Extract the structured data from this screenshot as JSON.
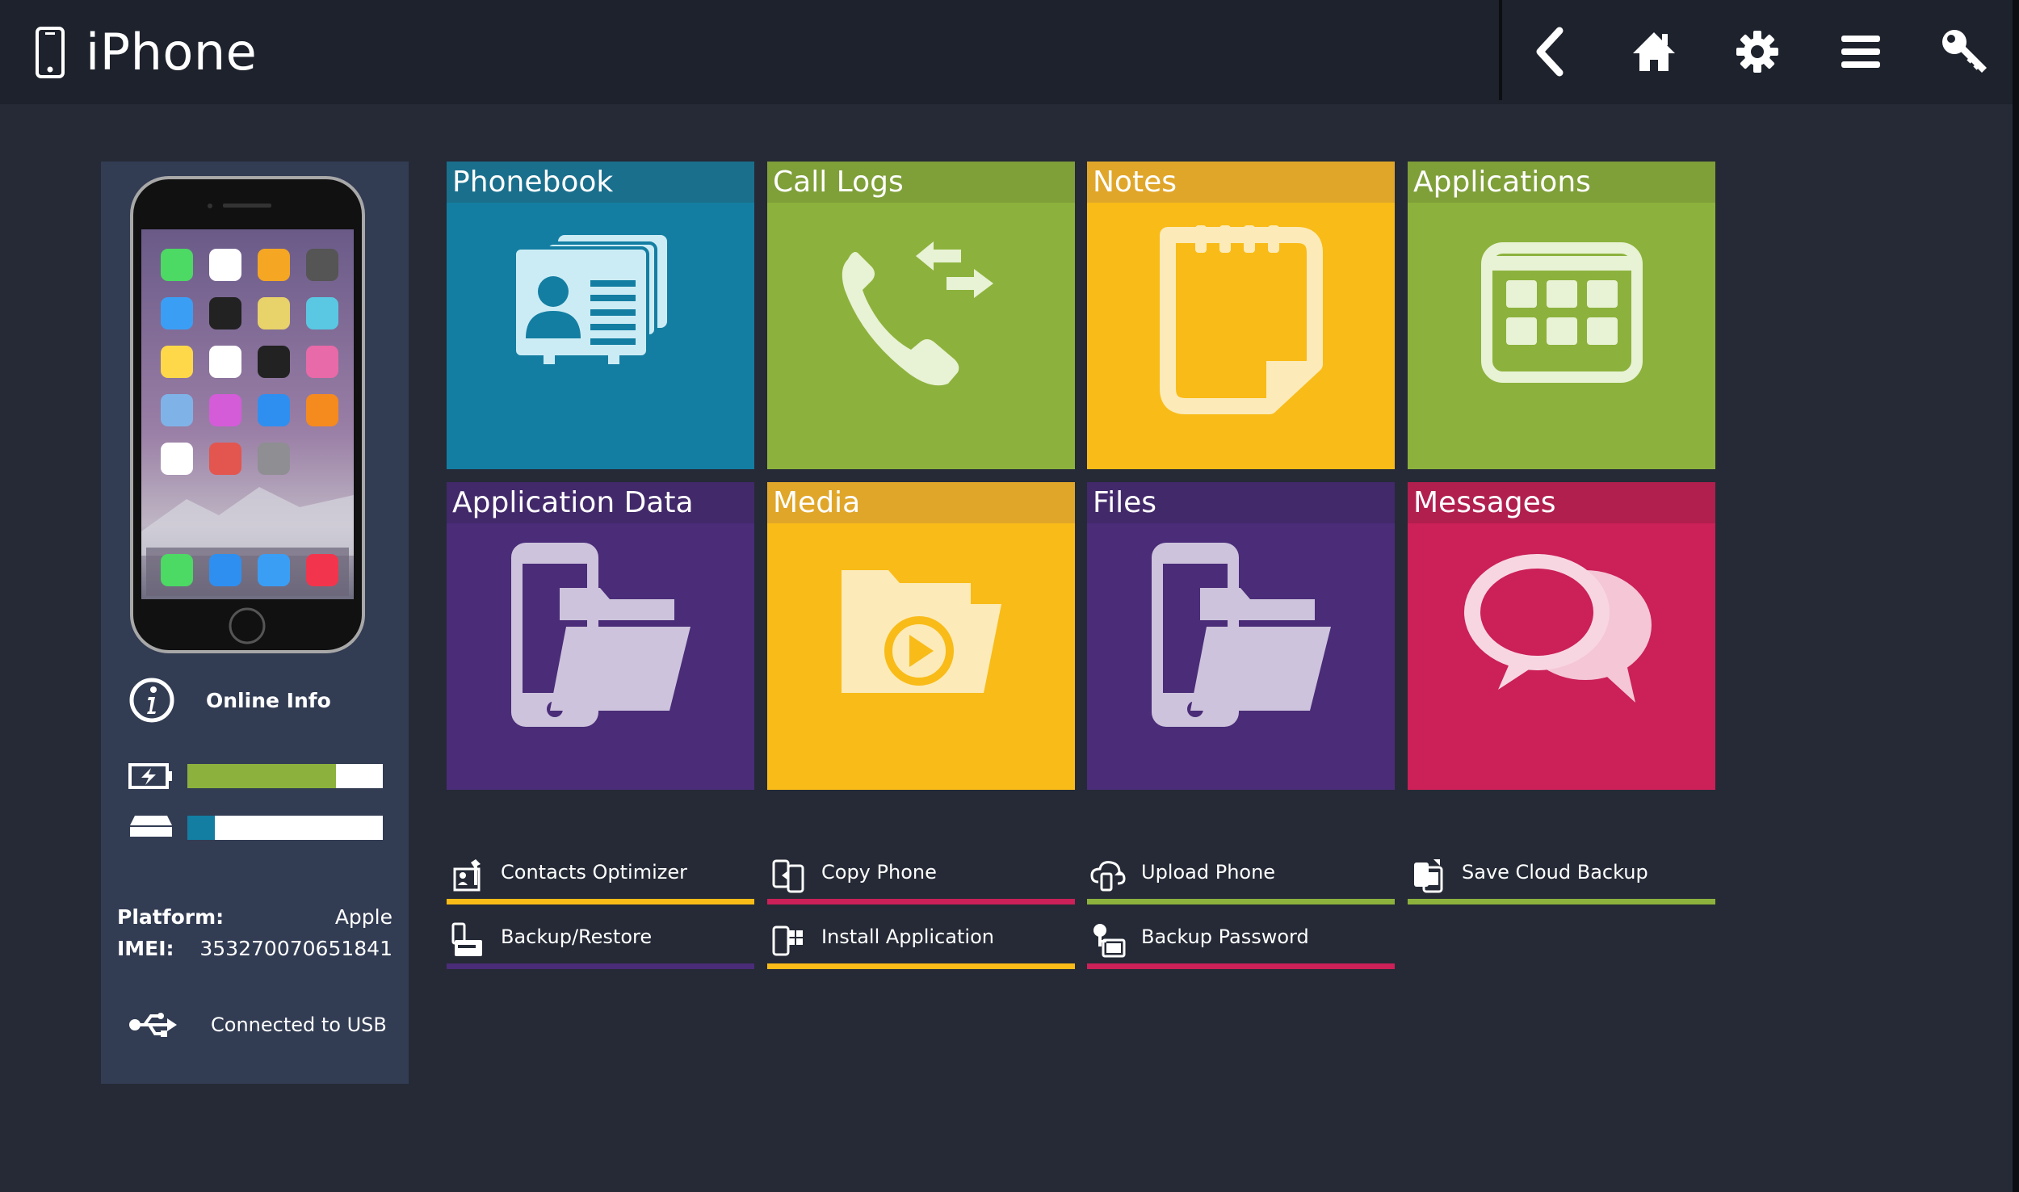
{
  "header": {
    "title": "iPhone",
    "buttons": [
      {
        "name": "back-button",
        "icon": "chevron-left-icon"
      },
      {
        "name": "home-button",
        "icon": "home-icon"
      },
      {
        "name": "settings-button",
        "icon": "gear-icon"
      },
      {
        "name": "menu-button",
        "icon": "hamburger-menu-icon"
      },
      {
        "name": "key-button",
        "icon": "key-icon"
      }
    ]
  },
  "device": {
    "online_info_label": "Online Info",
    "battery_level": 0.76,
    "storage_used": 0.14,
    "platform_label": "Platform:",
    "platform_value": "Apple",
    "imei_label": "IMEI:",
    "imei_value": "353270070651841",
    "connection": "Connected to USB"
  },
  "tiles": [
    {
      "label": "Phonebook",
      "icon": "contact-cards-icon",
      "color": "#137ea2",
      "header_color": "#1a6f8c"
    },
    {
      "label": "Call Logs",
      "icon": "phone-call-arrows-icon",
      "color": "#8cb23d",
      "header_color": "#7f9f39"
    },
    {
      "label": "Notes",
      "icon": "notepad-icon",
      "color": "#f9bb18",
      "header_color": "#e0a62a"
    },
    {
      "label": "Applications",
      "icon": "app-grid-icon",
      "color": "#8cb23d",
      "header_color": "#7f9f39"
    },
    {
      "label": "Application Data",
      "icon": "phone-folder-icon",
      "color": "#4a2c78",
      "header_color": "#42296a"
    },
    {
      "label": "Media",
      "icon": "media-folder-icon",
      "color": "#f9bb18",
      "header_color": "#e0a62a"
    },
    {
      "label": "Files",
      "icon": "phone-folder-icon",
      "color": "#4a2c78",
      "header_color": "#42296a"
    },
    {
      "label": "Messages",
      "icon": "chat-bubbles-icon",
      "color": "#cb2058",
      "header_color": "#b11f4f"
    }
  ],
  "actions": [
    {
      "label": "Contacts Optimizer",
      "icon": "contacts-optimizer-icon",
      "color": "#f9bb18"
    },
    {
      "label": "Copy Phone",
      "icon": "copy-phone-icon",
      "color": "#cb2058"
    },
    {
      "label": "Upload Phone",
      "icon": "upload-phone-icon",
      "color": "#8cb23d"
    },
    {
      "label": "Save Cloud Backup",
      "icon": "cloud-backup-icon",
      "color": "#8cb23d"
    },
    {
      "label": "Backup/Restore",
      "icon": "backup-restore-icon",
      "color": "#4a2c78"
    },
    {
      "label": "Install Application",
      "icon": "install-app-icon",
      "color": "#f9bb18"
    },
    {
      "label": "Backup Password",
      "icon": "backup-password-icon",
      "color": "#cb2058"
    }
  ],
  "colors": {
    "background": "#252a36",
    "header": "#1d222c",
    "panel": "#323c53",
    "battery": "#8cb23d",
    "storage": "#137ea2"
  }
}
